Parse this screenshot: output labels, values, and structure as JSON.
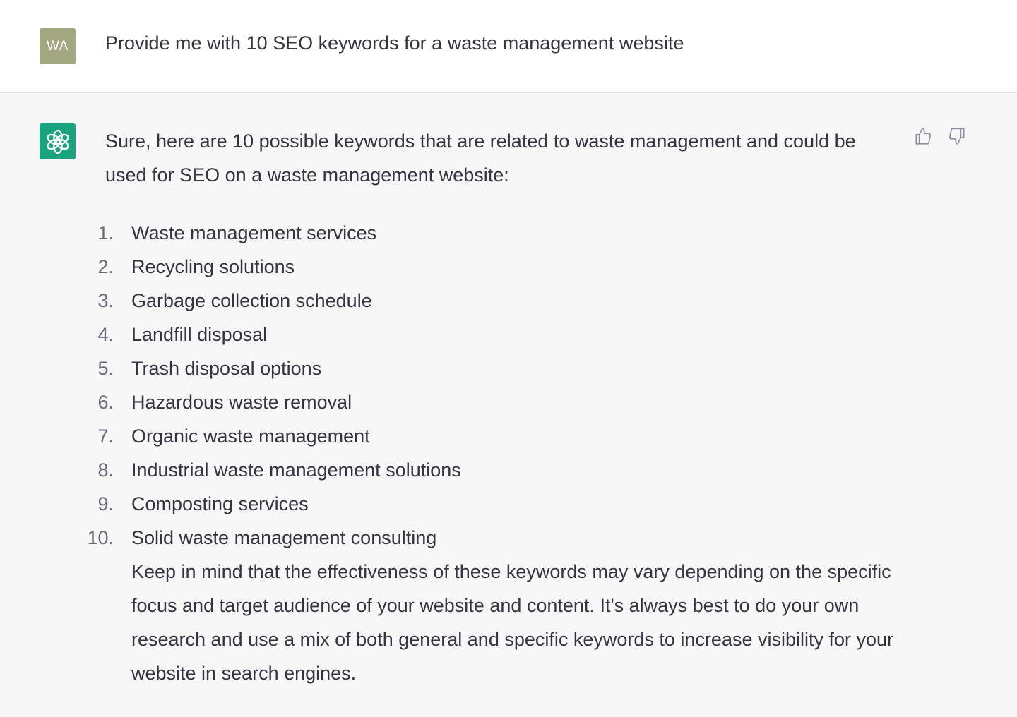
{
  "user": {
    "avatar_initials": "WA",
    "message": "Provide me with 10 SEO keywords for a waste management website"
  },
  "assistant": {
    "avatar_icon": "openai-logo-icon",
    "intro": "Sure, here are 10 possible keywords that are related to waste management and could be used for SEO on a waste management website:",
    "keywords": [
      {
        "number": "1.",
        "text": "Waste management services"
      },
      {
        "number": "2.",
        "text": "Recycling solutions"
      },
      {
        "number": "3.",
        "text": "Garbage collection schedule"
      },
      {
        "number": "4.",
        "text": "Landfill disposal"
      },
      {
        "number": "5.",
        "text": "Trash disposal options"
      },
      {
        "number": "6.",
        "text": "Hazardous waste removal"
      },
      {
        "number": "7.",
        "text": "Organic waste management"
      },
      {
        "number": "8.",
        "text": "Industrial waste management solutions"
      },
      {
        "number": "9.",
        "text": "Composting services"
      },
      {
        "number": "10.",
        "text": "Solid waste management consulting"
      }
    ],
    "outro": "Keep in mind that the effectiveness of these keywords may vary depending on the specific focus and target audience of your website and content. It's always best to do your own research and use a mix of both general and specific keywords to increase visibility for your website in search engines."
  },
  "feedback": {
    "like_icon": "thumbs-up-icon",
    "dislike_icon": "thumbs-down-icon"
  },
  "colors": {
    "user_avatar": "#a3a781",
    "assistant_avatar": "#19a37f",
    "assistant_bg": "#f7f7f8",
    "text": "#343541"
  }
}
